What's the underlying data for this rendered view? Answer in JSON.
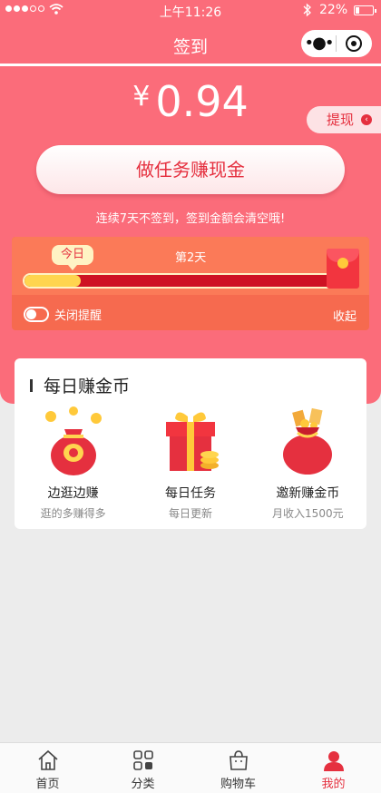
{
  "status_bar": {
    "time": "上午11:26",
    "battery": "22%"
  },
  "nav": {
    "title": "签到"
  },
  "balance": {
    "currency": "¥",
    "amount": "0.94"
  },
  "withdraw_label": "提现",
  "task_button_label": "做任务赚现金",
  "notice": "连续7天不签到，签到金额会清空哦!",
  "progress": {
    "today_label": "今日",
    "day2_label": "第2天",
    "fill_fraction": 0.17,
    "remind_label": "关闭提醒",
    "collapse_label": "收起"
  },
  "daily": {
    "title": "每日赚金币",
    "items": [
      {
        "label": "边逛边赚",
        "sub": "逛的多赚得多",
        "icon": "money-bag-icon"
      },
      {
        "label": "每日任务",
        "sub": "每日更新",
        "icon": "gift-box-icon"
      },
      {
        "label": "邀新赚金币",
        "sub": "月收入1500元",
        "icon": "lucky-bag-icon"
      }
    ]
  },
  "tabbar": [
    {
      "label": "首页",
      "icon": "home-icon",
      "active": false
    },
    {
      "label": "分类",
      "icon": "grid-icon",
      "active": false
    },
    {
      "label": "购物车",
      "icon": "bag-icon",
      "active": false
    },
    {
      "label": "我的",
      "icon": "user-icon",
      "active": true
    }
  ],
  "colors": {
    "brand": "#fb6c7a",
    "accent": "#e5303f",
    "progress_fill": "#ffd54f"
  }
}
